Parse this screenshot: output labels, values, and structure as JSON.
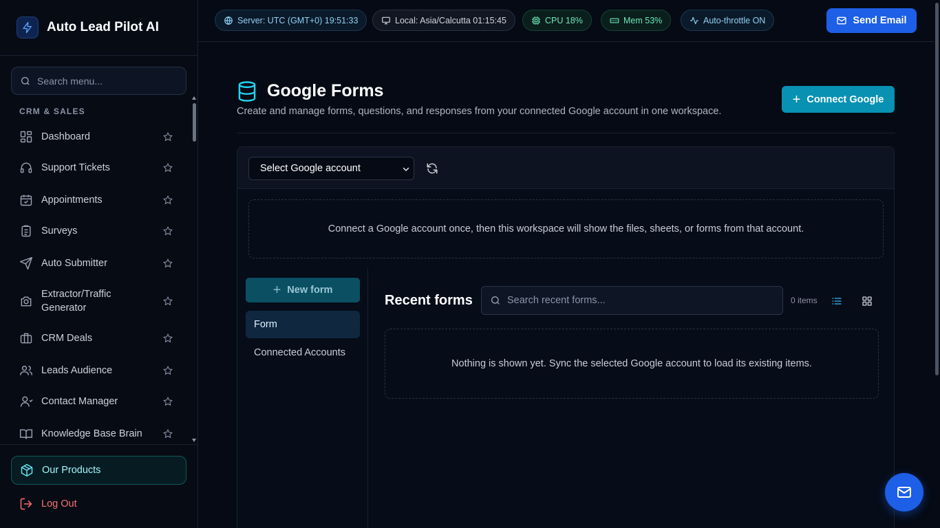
{
  "app": {
    "name": "Auto Lead Pilot AI"
  },
  "sidebar": {
    "search_placeholder": "Search menu...",
    "section_label": "CRM & SALES",
    "items": [
      {
        "label": "Dashboard",
        "icon": "dashboard-icon"
      },
      {
        "label": "Support Tickets",
        "icon": "headset-icon"
      },
      {
        "label": "Appointments",
        "icon": "calendar-check-icon"
      },
      {
        "label": "Surveys",
        "icon": "clipboard-icon"
      },
      {
        "label": "Auto Submitter",
        "icon": "send-icon"
      },
      {
        "label": "Extractor/Traffic Generator",
        "icon": "camera-icon"
      },
      {
        "label": "CRM Deals",
        "icon": "briefcase-icon"
      },
      {
        "label": "Leads Audience",
        "icon": "users-icon"
      },
      {
        "label": "Contact Manager",
        "icon": "contact-icon"
      },
      {
        "label": "Knowledge Base Brain",
        "icon": "book-icon"
      }
    ],
    "products_label": "Our Products",
    "logout_label": "Log Out"
  },
  "topbar": {
    "server": "Server: UTC (GMT+0) 19:51:33",
    "local": "Local: Asia/Calcutta 01:15:45",
    "cpu": "CPU 18%",
    "mem": "Mem 53%",
    "throttle": "Auto-throttle ON",
    "send_email": "Send Email"
  },
  "page": {
    "title": "Google Forms",
    "subtitle": "Create and manage forms, questions, and responses from your connected Google account in one workspace.",
    "connect_button": "Connect Google",
    "account_select": "Select Google account",
    "notice": "Connect a Google account once, then this workspace will show the files, sheets, or forms from that account.",
    "new_form": "New form",
    "tabs": [
      "Form",
      "Connected Accounts"
    ],
    "recent_title": "Recent forms",
    "recent_search_placeholder": "Search recent forms...",
    "items_count": "0 items",
    "empty_message": "Nothing is shown yet. Sync the selected Google account to load its existing items."
  },
  "colors": {
    "accent": "#0891b2",
    "primary": "#1d5fe6",
    "danger": "#f87171",
    "background": "#050a14"
  }
}
